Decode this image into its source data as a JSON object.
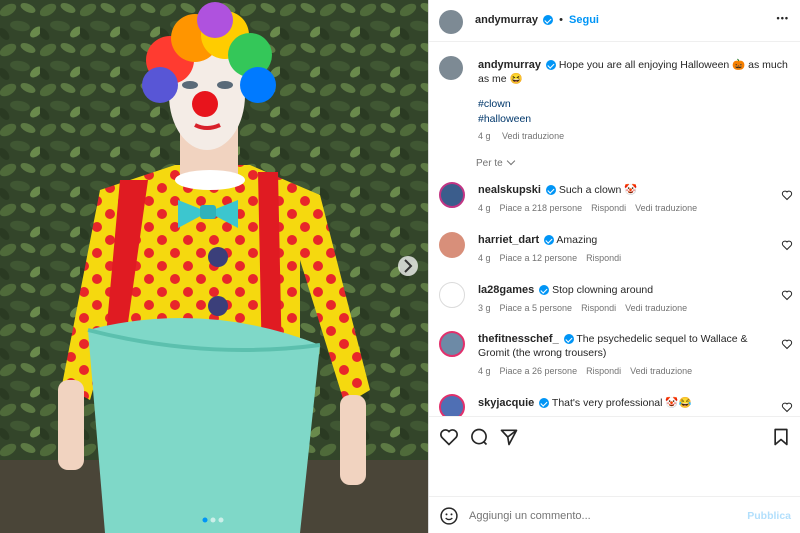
{
  "post": {
    "author": "andymurray",
    "follow_label": "Segui",
    "dot": "•",
    "more": "•••",
    "caption": "Hope you are all enjoying Halloween 🎃 as much as me 😆",
    "hashtags": [
      "#clown",
      "#halloween"
    ],
    "age": "4 g",
    "translate": "Vedi traduzione"
  },
  "filter_label": "Per te",
  "comments": [
    {
      "user": "nealskupski",
      "text": "Such a clown 🤡",
      "age": "4 g",
      "likes": "Piace a 218 persone",
      "reply": "Rispondi",
      "translate": "Vedi traduzione"
    },
    {
      "user": "harriet_dart",
      "text": "Amazing",
      "age": "4 g",
      "likes": "Piace a 12 persone",
      "reply": "Rispondi",
      "translate": ""
    },
    {
      "user": "la28games",
      "text": "Stop clowning around",
      "age": "3 g",
      "likes": "Piace a 5 persone",
      "reply": "Rispondi",
      "translate": "Vedi traduzione"
    },
    {
      "user": "thefitnesschef_",
      "text": "The psychedelic sequel to Wallace & Gromit (the wrong trousers)",
      "age": "4 g",
      "likes": "Piace a 26 persone",
      "reply": "Rispondi",
      "translate": "Vedi traduzione"
    },
    {
      "user": "skyjacquie",
      "text": "That's very professional 🤡😂",
      "age": "",
      "likes": "",
      "reply": "",
      "translate": ""
    }
  ],
  "composer": {
    "placeholder": "Aggiungi un commento...",
    "publish": "Pubblica"
  },
  "carousel": {
    "slides": 3,
    "active": 0
  },
  "icons": [
    "emoji-icon",
    "heart-icon",
    "comment-icon",
    "share-icon",
    "save-icon",
    "chevron-right-icon",
    "more-icon",
    "verified-icon"
  ],
  "colors": {
    "accent": "#0095f6",
    "suit_yellow": "#f5d90f",
    "dots": "#e8262a",
    "trousers": "#7fd8c8"
  }
}
